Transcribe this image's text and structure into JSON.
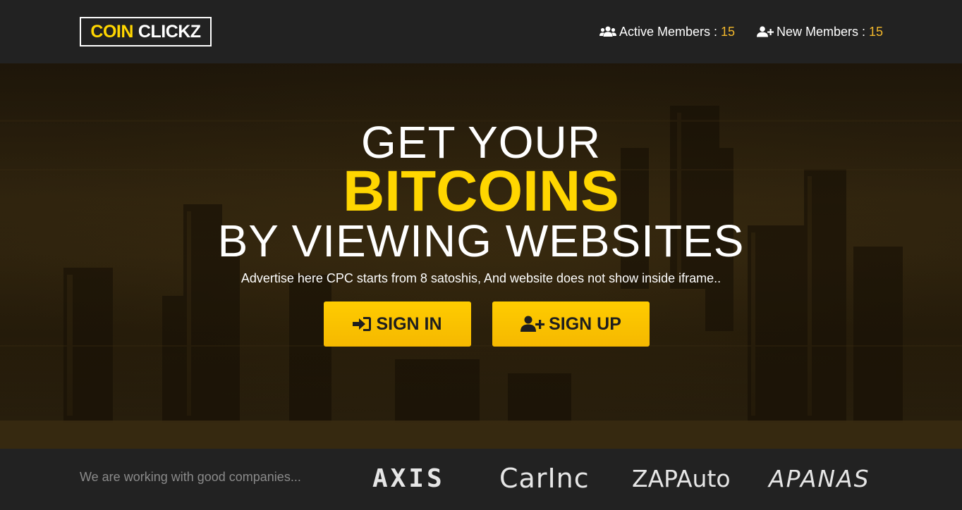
{
  "header": {
    "logo_part1": "COIN",
    "logo_part2": "CLICKZ",
    "active_members_label": "Active Members :",
    "active_members_count": "15",
    "new_members_label": "New Members :",
    "new_members_count": "15"
  },
  "hero": {
    "line1": "GET YOUR",
    "line2": "BITCOINS",
    "line3": "BY VIEWING WEBSITES",
    "subtitle": "Advertise here CPC starts from 8 satoshis, And website does not show inside iframe..",
    "signin_label": "SIGN IN",
    "signup_label": "SIGN UP"
  },
  "footer": {
    "partners_text": "We are working with good companies...",
    "partners": [
      "AXIS",
      "CarInc",
      "ZAPAuto",
      "APANAS"
    ]
  },
  "icons": {
    "active_members": "users-icon",
    "new_members": "user-plus-icon",
    "signin": "sign-in-icon",
    "signup": "user-plus-icon"
  },
  "colors": {
    "accent": "#ffd600",
    "button": "#ffc400",
    "count": "#f2b72b",
    "header_bg": "#222222"
  }
}
